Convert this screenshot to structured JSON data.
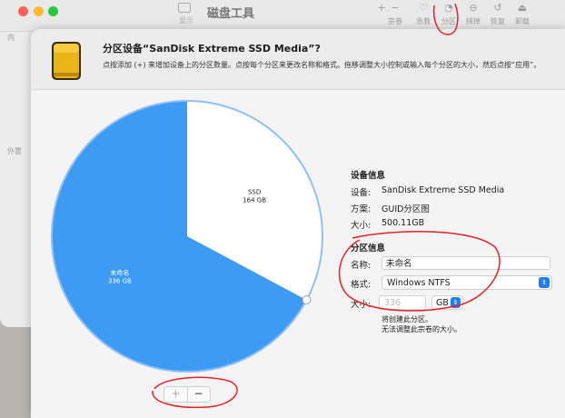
{
  "background_window": {
    "title": "磁盘工具",
    "view_label": "显示",
    "toolbar": [
      {
        "icon": "plus-icon",
        "glyph": "+",
        "label": ""
      },
      {
        "icon": "minus-icon",
        "glyph": "−",
        "label": "宗卷"
      },
      {
        "icon": "first-aid-icon",
        "glyph": "♡",
        "label": "急救"
      },
      {
        "icon": "partition-icon",
        "glyph": "◔",
        "label": "分区"
      },
      {
        "icon": "erase-icon",
        "glyph": "⊖",
        "label": "抹掉"
      },
      {
        "icon": "restore-icon",
        "glyph": "↺",
        "label": "恢复"
      },
      {
        "icon": "unmount-icon",
        "glyph": "⏏",
        "label": "卸载"
      }
    ],
    "sidebar_hints": [
      "内",
      "外置"
    ]
  },
  "sheet": {
    "title": "分区设备“SanDisk Extreme SSD Media”?",
    "description": "点按添加 (+) 来增加设备上的分区数量。点按每个分区来更改名称和格式。拖移调整大小控制或输入每个分区的大小，然后点按“应用”。",
    "device_icon": "external-drive-icon"
  },
  "pie": {
    "total_gb": 500,
    "slices": [
      {
        "name": "SSD",
        "size": "164 GB",
        "value": 164,
        "color": "#ffffff"
      },
      {
        "name": "未命名",
        "size": "336 GB",
        "value": 336,
        "color": "#3d9bf3"
      }
    ]
  },
  "device_info": {
    "heading": "设备信息",
    "rows": [
      {
        "label": "设备:",
        "value": "SanDisk Extreme SSD Media"
      },
      {
        "label": "方案:",
        "value": "GUID分区图"
      },
      {
        "label": "大小:",
        "value": "500.11GB"
      }
    ]
  },
  "partition_info": {
    "heading": "分区信息",
    "name_label": "名称:",
    "name_value": "未命名",
    "format_label": "格式:",
    "format_value": "Windows NTFS",
    "size_label": "大小:",
    "size_value": "336",
    "unit": "GB",
    "note_lines": [
      "将创建此分区。",
      "无法调整此宗卷的大小。"
    ]
  },
  "controls": {
    "add_label": "+",
    "remove_label": "−"
  },
  "colors": {
    "accent": "#1f7cf1",
    "pie_fill": "#3d9bf3",
    "annotation": "#e8202a"
  }
}
